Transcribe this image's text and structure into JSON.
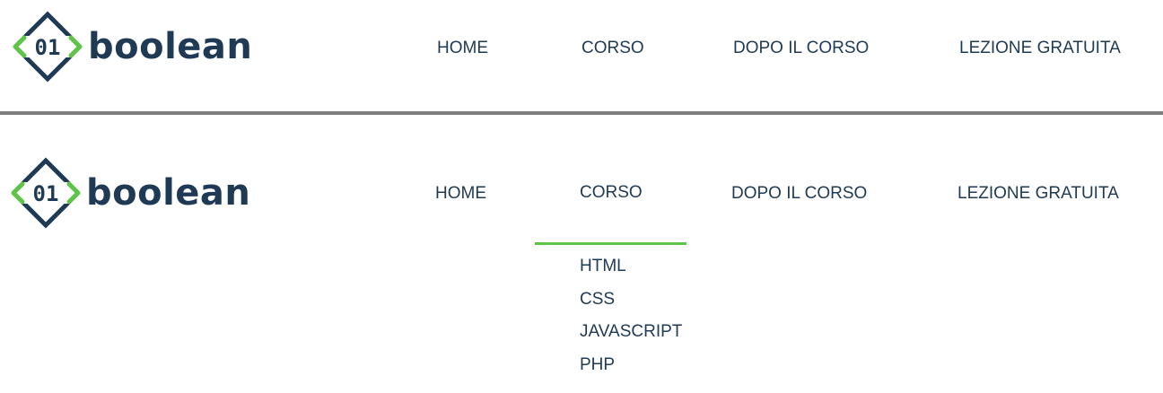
{
  "brand": {
    "logo_word": "boolean",
    "logo_glyph": "01",
    "colors": {
      "primary": "#1f3a55",
      "accent": "#5ec447",
      "separator": "#7f7f7f"
    }
  },
  "header_default": {
    "nav": [
      {
        "label": "HOME"
      },
      {
        "label": "CORSO"
      },
      {
        "label": "DOPO IL CORSO"
      },
      {
        "label": "LEZIONE GRATUITA"
      }
    ]
  },
  "header_hover": {
    "active": "CORSO",
    "nav": [
      {
        "label": "HOME"
      },
      {
        "label": "CORSO"
      },
      {
        "label": "DOPO IL CORSO"
      },
      {
        "label": "LEZIONE GRATUITA"
      }
    ],
    "dropdown": [
      {
        "label": "HTML"
      },
      {
        "label": "CSS"
      },
      {
        "label": "JAVASCRIPT"
      },
      {
        "label": "PHP"
      }
    ]
  }
}
